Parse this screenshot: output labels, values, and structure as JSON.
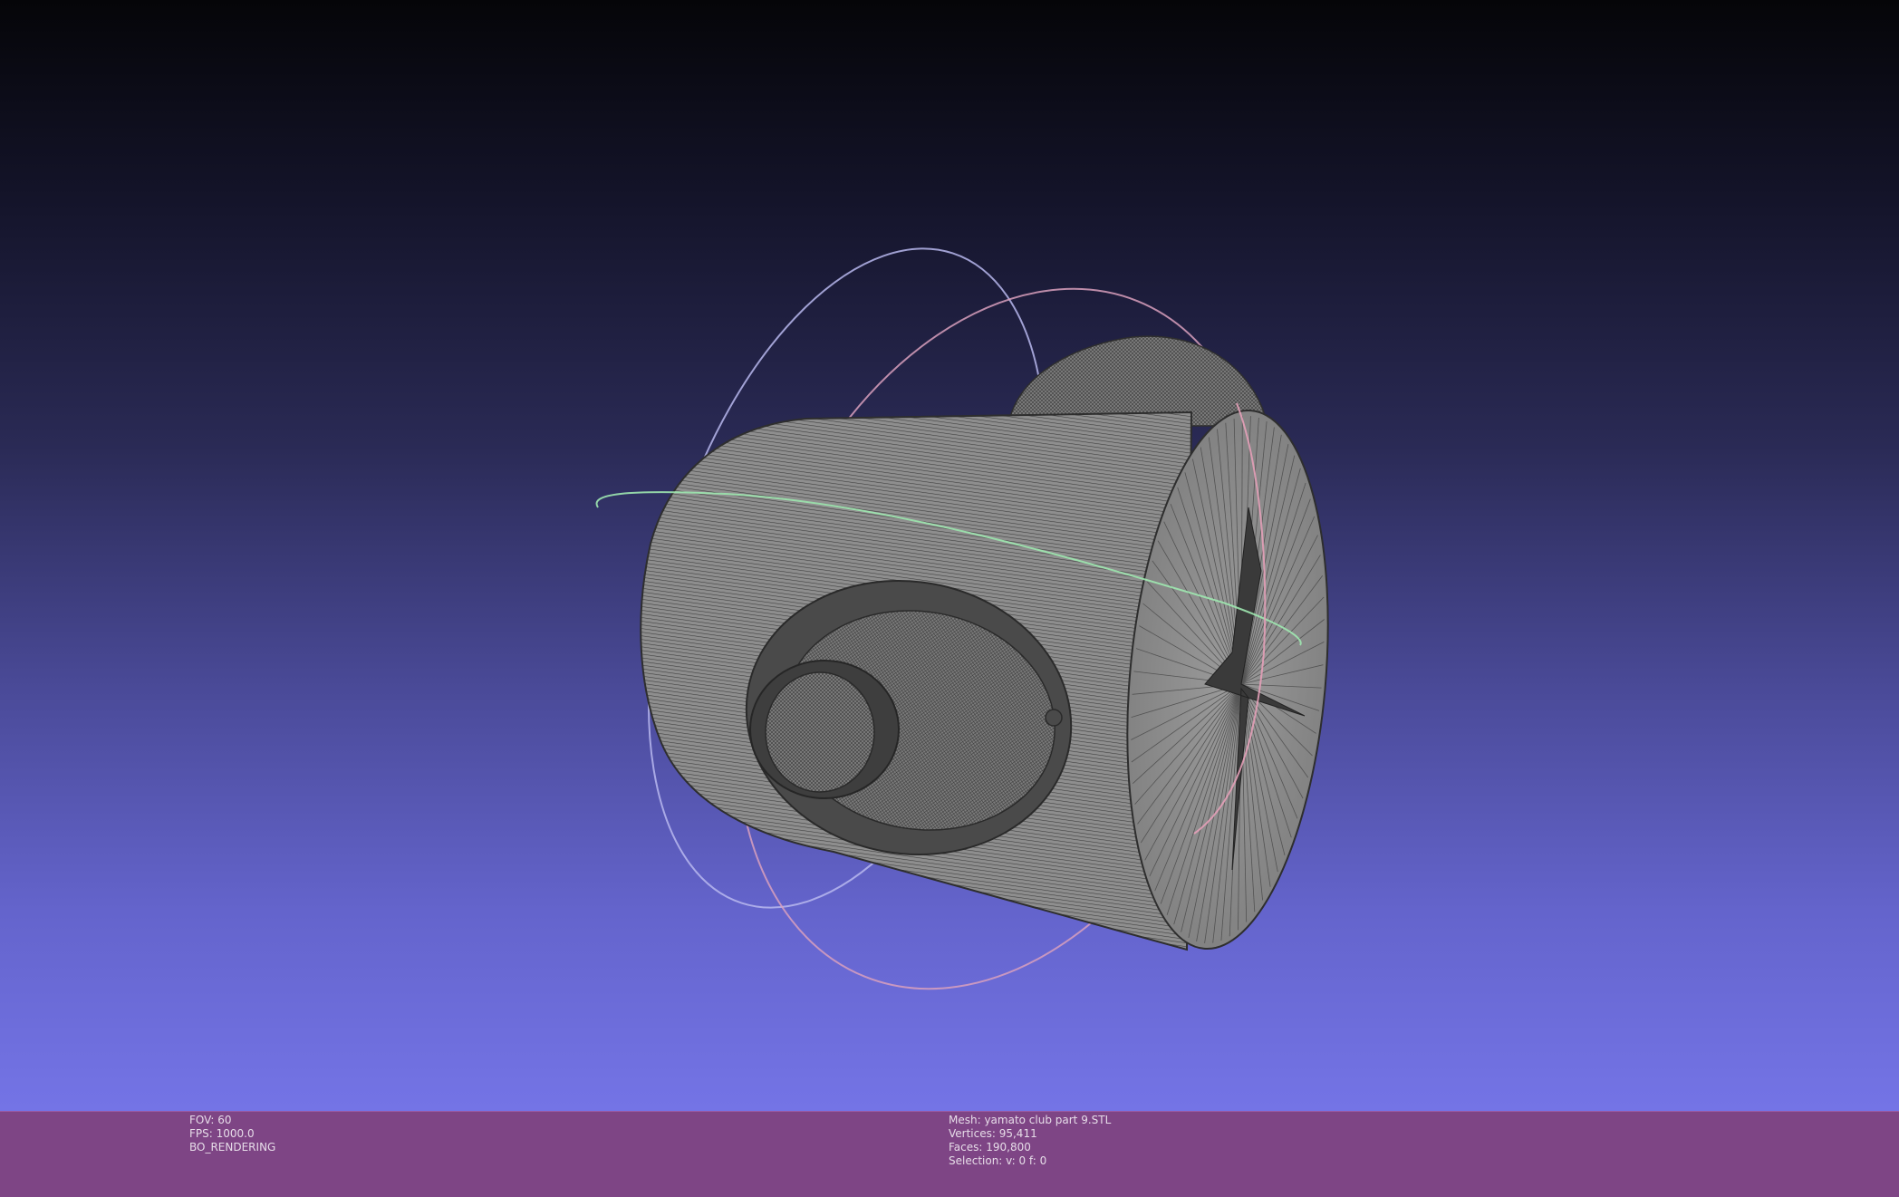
{
  "viewport": {
    "background_top": "#050508",
    "background_bottom": "#7474e6",
    "mesh_color": "#8a8a8a",
    "wire_color": "#3a3a3a",
    "trackball": {
      "x_ring_color": "#f0a8b8",
      "y_ring_color": "#a8f0b8",
      "z_ring_color": "#b8b8f0"
    }
  },
  "status": {
    "left": {
      "fov": "FOV: 60",
      "fps": "FPS:  1000.0",
      "mode": "BO_RENDERING"
    },
    "center": {
      "mesh": "Mesh: yamato club part 9.STL",
      "vertices": "Vertices: 95,411",
      "faces": "Faces: 190,800",
      "selection": "Selection: v: 0 f: 0"
    },
    "bar_color": "#7e4585"
  }
}
